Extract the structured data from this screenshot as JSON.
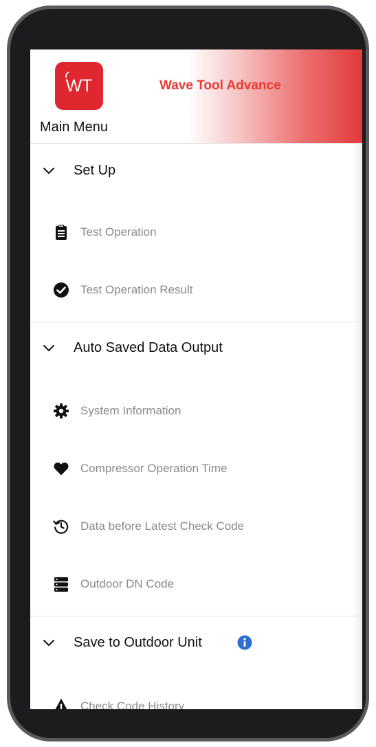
{
  "header": {
    "logo_text": "WT",
    "app_title": "Wave Tool Advance",
    "menu_title": "Main Menu"
  },
  "sections": [
    {
      "label": "Set Up",
      "items": [
        {
          "label": "Test Operation",
          "icon": "clipboard-icon"
        },
        {
          "label": "Test Operation Result",
          "icon": "check-circle-icon"
        }
      ]
    },
    {
      "label": "Auto Saved Data Output",
      "items": [
        {
          "label": "System Information",
          "icon": "gear-icon"
        },
        {
          "label": "Compressor Operation Time",
          "icon": "heart-icon"
        },
        {
          "label": "Data before Latest Check Code",
          "icon": "history-icon"
        },
        {
          "label": "Outdoor DN Code",
          "icon": "server-icon"
        }
      ]
    },
    {
      "label": "Save to Outdoor Unit",
      "has_info": true,
      "items": [
        {
          "label": "Check Code History",
          "icon": "warning-icon"
        }
      ]
    }
  ],
  "colors": {
    "accent": "#e63c35",
    "logo_bg": "#e0262e",
    "info_blue": "#2d6fd1"
  }
}
